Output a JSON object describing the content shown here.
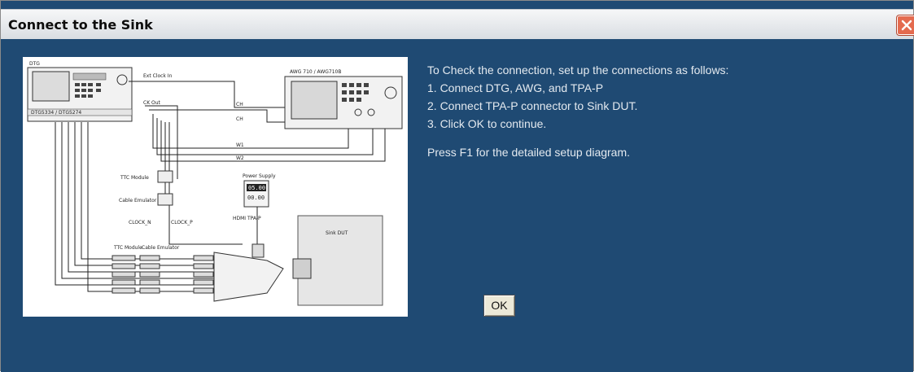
{
  "window": {
    "title": "Connect to the Sink",
    "close_icon": "close-icon",
    "background_color": "#1f4a73"
  },
  "diagram": {
    "labels": {
      "dtg": "DTG",
      "ext_clock": "Ext Clock In",
      "awg": "AWG 710 / AWG710B",
      "dtg_model": "DTG5334 / DTG5274",
      "ck_out": "CK Out",
      "ttc_module": "TTC Module",
      "cable_emulator": "Cable Emulator",
      "clock_n": "CLOCK_N",
      "clock_p": "CLOCK_P",
      "power_supply": "Power Supply",
      "ps_value1": "05.00",
      "ps_value2": "00.00",
      "hdmi_tpa": "HDMI TPA-P",
      "sink_dut": "Sink DUT",
      "ttc_module2": "TTC Module",
      "cable_emulator2": "Cable Emulator",
      "ch": "CH",
      "ch2": "CH",
      "w1": "W1",
      "w2": "W2"
    }
  },
  "instructions": {
    "intro": "To Check the connection, set up the connections as follows:",
    "step1": "1. Connect DTG, AWG, and TPA-P",
    "step2": "2. Connect TPA-P connector to Sink DUT.",
    "step3": "3. Click OK to continue.",
    "help": "Press F1 for the detailed setup diagram."
  },
  "buttons": {
    "ok_label": "OK"
  }
}
